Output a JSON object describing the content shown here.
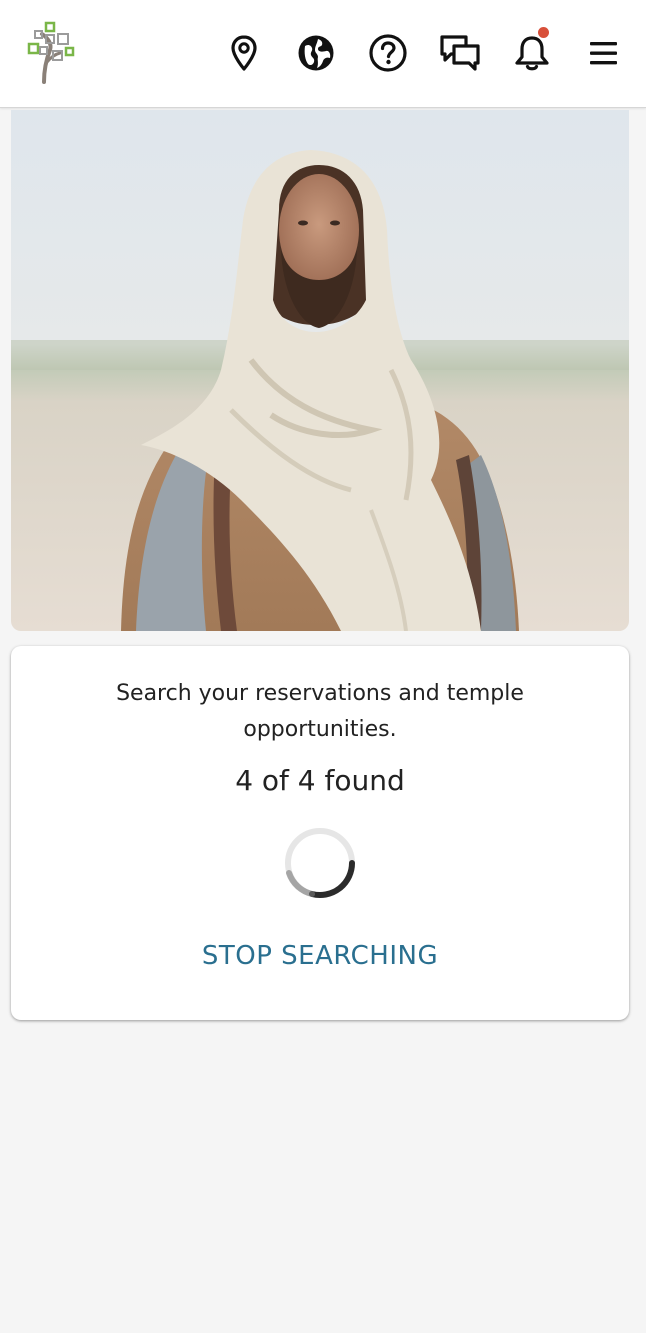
{
  "header": {
    "logo_icon": "family-tree-logo",
    "icons": [
      "location-pin-icon",
      "globe-icon",
      "help-icon",
      "chat-icon",
      "bell-icon",
      "menu-icon"
    ],
    "notification_dot_color": "#d8503a"
  },
  "hero": {
    "image": "portrait-of-christ-in-white-shawl"
  },
  "search_card": {
    "message": "Search your reservations and temple opportunities.",
    "count_text": "4 of 4 found",
    "stop_label": "STOP SEARCHING",
    "accent_color": "#2a6f8f"
  }
}
